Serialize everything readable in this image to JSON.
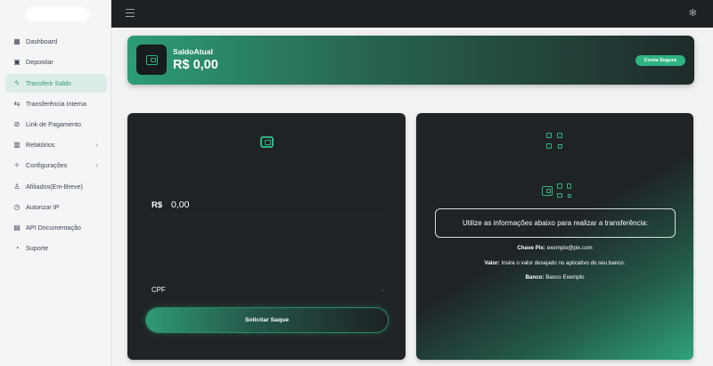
{
  "sidebar": {
    "items": [
      {
        "label": "Dashboard",
        "icon": "grid-icon"
      },
      {
        "label": "Depositar",
        "icon": "calendar-icon"
      },
      {
        "label": "Transferir Saldo",
        "icon": "bolt-icon"
      },
      {
        "label": "Transferência Interna",
        "icon": "arrows-icon"
      },
      {
        "label": "Link de Pagamento",
        "icon": "link-icon"
      },
      {
        "label": "Relatórios",
        "icon": "chart-icon"
      },
      {
        "label": "Configurações",
        "icon": "sliders-icon"
      },
      {
        "label": "Afiliados(Em-Breve)",
        "icon": "user-icon"
      },
      {
        "label": "Autorizar IP",
        "icon": "clock-icon"
      },
      {
        "label": "API Documentação",
        "icon": "document-icon"
      },
      {
        "label": "Suporte",
        "icon": "support-icon"
      }
    ]
  },
  "balance": {
    "label": "SaldoAtual",
    "value": "R$ 0,00",
    "badge": "Conta Segura"
  },
  "withdraw": {
    "currency": "R$",
    "amount": "0,00",
    "key_type": "CPF",
    "button_label": "Solicitar Saque"
  },
  "deposit_info": {
    "instructions": "Utilize as informações abaixo para realizar a transferência:",
    "pix_key_label": "Chave Pix:",
    "pix_key_value": "exemplo@pix.com",
    "value_label": "Valor:",
    "value_text": "Insira o valor desejado no aplicativo do seu banco.",
    "bank_label": "Banco:",
    "bank_value": "Banco Exemplo"
  },
  "colors": {
    "accent": "#2fb381",
    "dark_panel": "#1f2326",
    "topbar": "#1d2124",
    "active_nav_bg": "#dcece6"
  }
}
